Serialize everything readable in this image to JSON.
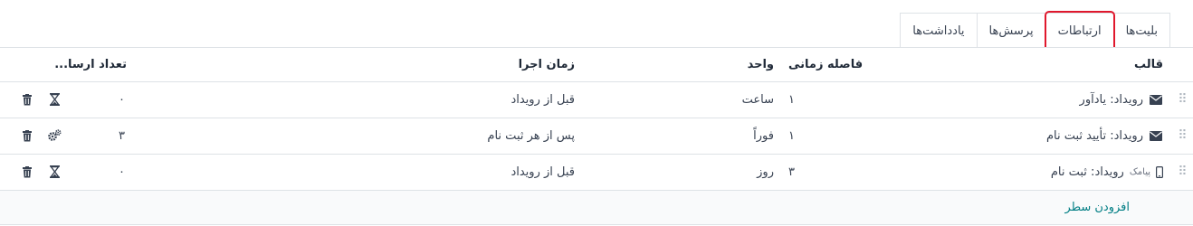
{
  "tabs": [
    {
      "label": "بلیت‌ها"
    },
    {
      "label": "ارتباطات"
    },
    {
      "label": "پرسش‌ها"
    },
    {
      "label": "یادداشت‌ها"
    }
  ],
  "table": {
    "headers": {
      "template": "قالب",
      "interval": "فاصله زمانی",
      "unit": "واحد",
      "trigger": "زمان اجرا",
      "count": "تعداد ارسا..."
    },
    "rows": [
      {
        "type_icon": "envelope-icon",
        "type_tag": "",
        "template": "رویداد: یادآور",
        "interval": "۱",
        "unit": "ساعت",
        "trigger": "قبل از رویداد",
        "count": "۰",
        "status_icon": "hourglass-icon"
      },
      {
        "type_icon": "envelope-icon",
        "type_tag": "",
        "template": "رویداد: تأیید ثبت نام",
        "interval": "۱",
        "unit": "فوراً",
        "trigger": "پس از هر ثبت نام",
        "count": "۳",
        "status_icon": "gears-icon"
      },
      {
        "type_icon": "mobile-icon",
        "type_tag": "پیامک",
        "template": "رویداد: ثبت نام",
        "interval": "۳",
        "unit": "روز",
        "trigger": "قبل از رویداد",
        "count": "۰",
        "status_icon": "hourglass-icon"
      }
    ],
    "add_line": "افزودن سطر"
  },
  "colors": {
    "accent": "#017e84",
    "highlight": "#e0182d"
  }
}
